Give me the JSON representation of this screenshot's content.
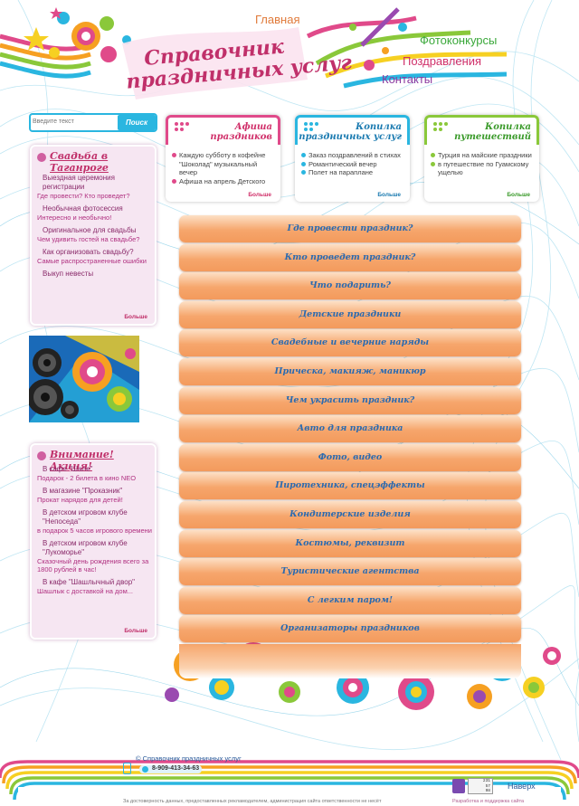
{
  "header": {
    "logo_line1": "Справочник",
    "logo_line2": "праздничных услуг",
    "nav": {
      "home": "Главная",
      "photo_contests": "Фотоконкурсы",
      "greetings": "Поздравления",
      "contacts": "Контакты"
    }
  },
  "search": {
    "placeholder": "Введите текст",
    "button_label": "Поиск"
  },
  "top_boxes": [
    {
      "title_line1": "Афиша",
      "title_line2": "праздников",
      "items": [
        "Каждую субботу в кофейне \"Шоколад\" музыкальный вечер",
        "Афиша на апрель Детского"
      ],
      "more": "Больше"
    },
    {
      "title_line1": "Копилка",
      "title_line2": "праздничных услуг",
      "items": [
        "Заказ поздравлений в стихах",
        "Романтический вечер",
        "Полет на параплане"
      ],
      "more": "Больше"
    },
    {
      "title_line1": "Копилка",
      "title_line2": "путешествий",
      "items": [
        "Турция на майские праздники",
        "в путешествие по Гуамскому ущелью"
      ],
      "more": "Больше"
    }
  ],
  "sidebar_wedding": {
    "title": "Свадьба в Таганроге",
    "items": [
      {
        "title": "Выездная церемония регистрации",
        "sub": "Где провести? Кто проведет?"
      },
      {
        "title": "Необычная фотосессия",
        "sub": "Интересно и необычно!"
      },
      {
        "title": "Оригинальное для свадьбы",
        "sub": "Чем удивить гостей на свадьбе?"
      },
      {
        "title": "Как организовать свадьбу?",
        "sub": "Самые распространенные ошибки"
      },
      {
        "title": "Выкуп невесты",
        "sub": ""
      }
    ],
    "more": "Больше"
  },
  "sidebar_promo": {
    "title": "Внимание! Акция!",
    "items": [
      {
        "title": "В кафе \"Шале\"",
        "sub": "Подарок - 2 билета в кино NEO"
      },
      {
        "title": "В магазине \"Проказник\"",
        "sub": "Прокат нарядов для детей!"
      },
      {
        "title": "В детском игровом клубе \"Непоседа\"",
        "sub": "в подарок 5 часов игрового времени"
      },
      {
        "title": "В детском игровом клубе \"Лукоморье\"",
        "sub": "Сказочный день рождения всего за 1800 рублей в час!"
      },
      {
        "title": "В кафе \"Шашлычный двор\"",
        "sub": "Шашлык с доставкой на дом..."
      }
    ],
    "more": "Больше"
  },
  "categories": [
    "Где провести праздник?",
    "Кто проведет праздник?",
    "Что подарить?",
    "Детские праздники",
    "Свадебные и вечерние наряды",
    "Прическа, макияж, маникюр",
    "Чем украсить праздник?",
    "Авто для праздника",
    "Фото, видео",
    "Пиротехника, спецэффекты",
    "Кондитерские изделия",
    "Костюмы, реквизит",
    "Туристические агентства",
    "С легким паром!",
    "Организаторы праздников"
  ],
  "footer": {
    "copyright": "© Справочник праздничных услуг",
    "phone": "8-909-413-34-63",
    "disclaimer": "За достоверность данных, предоставленных рекламодателем, администрация сайта ответственности не несёт",
    "counter": [
      "231",
      "57",
      "98"
    ],
    "top_link": "Наверх",
    "developer": "Разработка и поддержка сайта"
  },
  "colors": {
    "accent_pink": "#c0306a",
    "accent_blue": "#2ab6e0",
    "accent_green": "#8ac83a",
    "menu_orange": "#f6a66c",
    "menu_text": "#2a6ab0"
  }
}
